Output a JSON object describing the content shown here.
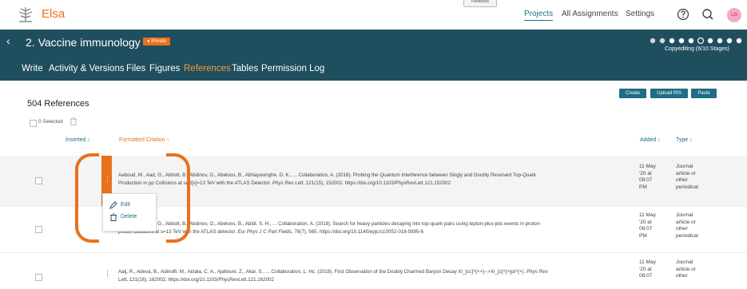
{
  "app": {
    "brand": "Elsa",
    "feedback": "Feedback"
  },
  "nav": {
    "projects": "Projects",
    "assignments": "All Assignments",
    "settings": "Settings"
  },
  "user": {
    "initials": "LG"
  },
  "project": {
    "title": "2. Vaccine immunology",
    "privacy": "Private",
    "stages": "Copyediting (6/10 Stages)"
  },
  "tabs": [
    "Write",
    "Activity & Versions",
    "Files",
    "Figures",
    "References",
    "Tables",
    "Permission Log"
  ],
  "active_tab": "References",
  "buttons": {
    "create": "Create",
    "upload": "Upload RIS",
    "paste": "Paste"
  },
  "references": {
    "count": "504 References",
    "selected": "0 Selected"
  },
  "columns": {
    "inserted": "Inserted ↓",
    "citation": "Formatted Citation ↑",
    "added": "Added ↓",
    "type": "Type ↓"
  },
  "rows": [
    {
      "c1": "Aaboud, M., Aad, G., Abbott, B., Abdinov, O., Abeloos, B., Abhayasinghe, D. K., ... Collaboration, A. (2018). Probing the Quantum Interference between Singly and Doubly Resonant Top-Quark",
      "c2": "Production in pp Collisions at sqrt[s]=13 TeV with the ATLAS Detector. ",
      "journal": "Phys Rev Lett",
      "c3": ", 121(15), 152002. https://doi.org/10.1103/PhysRevLett.121.152002",
      "added": [
        "11 May",
        "'20 at",
        "08:07",
        "PM"
      ],
      "type": [
        "Journal",
        "article or",
        "other",
        "periodical"
      ]
    },
    {
      "c1": "Aaboud, M., Aad, G., Abbott, B., Abdinov, O., Abeloos, B., Abidi, S. H., ... Collaboration, A. (2018). Search for heavy particles decaying into top-quark pairs using lepton-plus-jets events in proton-",
      "c2": "proton collisions at s=13 TeV with the ATLAS detector. ",
      "journal": "Eur Phys J C Part Fields",
      "c3": ", 78(7), 565. https://doi.org/10.1140/epjc/s10052-018-5995-6",
      "added": [
        "11 May",
        "'20 at",
        "08:07",
        "PM"
      ],
      "type": [
        "Journal",
        "article or",
        "other",
        "periodical"
      ]
    },
    {
      "c1": "Aaij, R., Adeva, B., Adinolfi, M., Aidala, C. A., Ajaltouni, Z., Akar, S., ... Collaboration, L. Hc. (2018). First Observation of the Doubly Charmed Baryon Decay Xi_[cc]^{++}-->Xi_[c]^{+}pi^{+}. ",
      "c2": "Lett, 121(16), 162002. https://doi.org/10.1103/PhysRevLett.121.162002",
      "journal": "Phys Rev",
      "c3": "",
      "added": [
        "11 May",
        "'20 at",
        "08:07"
      ],
      "type": [
        "Journal",
        "article or",
        "other"
      ]
    }
  ],
  "menu": {
    "edit": "Edit",
    "delete": "Delete"
  },
  "colors": {
    "accent": "#e9711c",
    "header": "#1f4e5e",
    "link": "#1f6d86"
  }
}
